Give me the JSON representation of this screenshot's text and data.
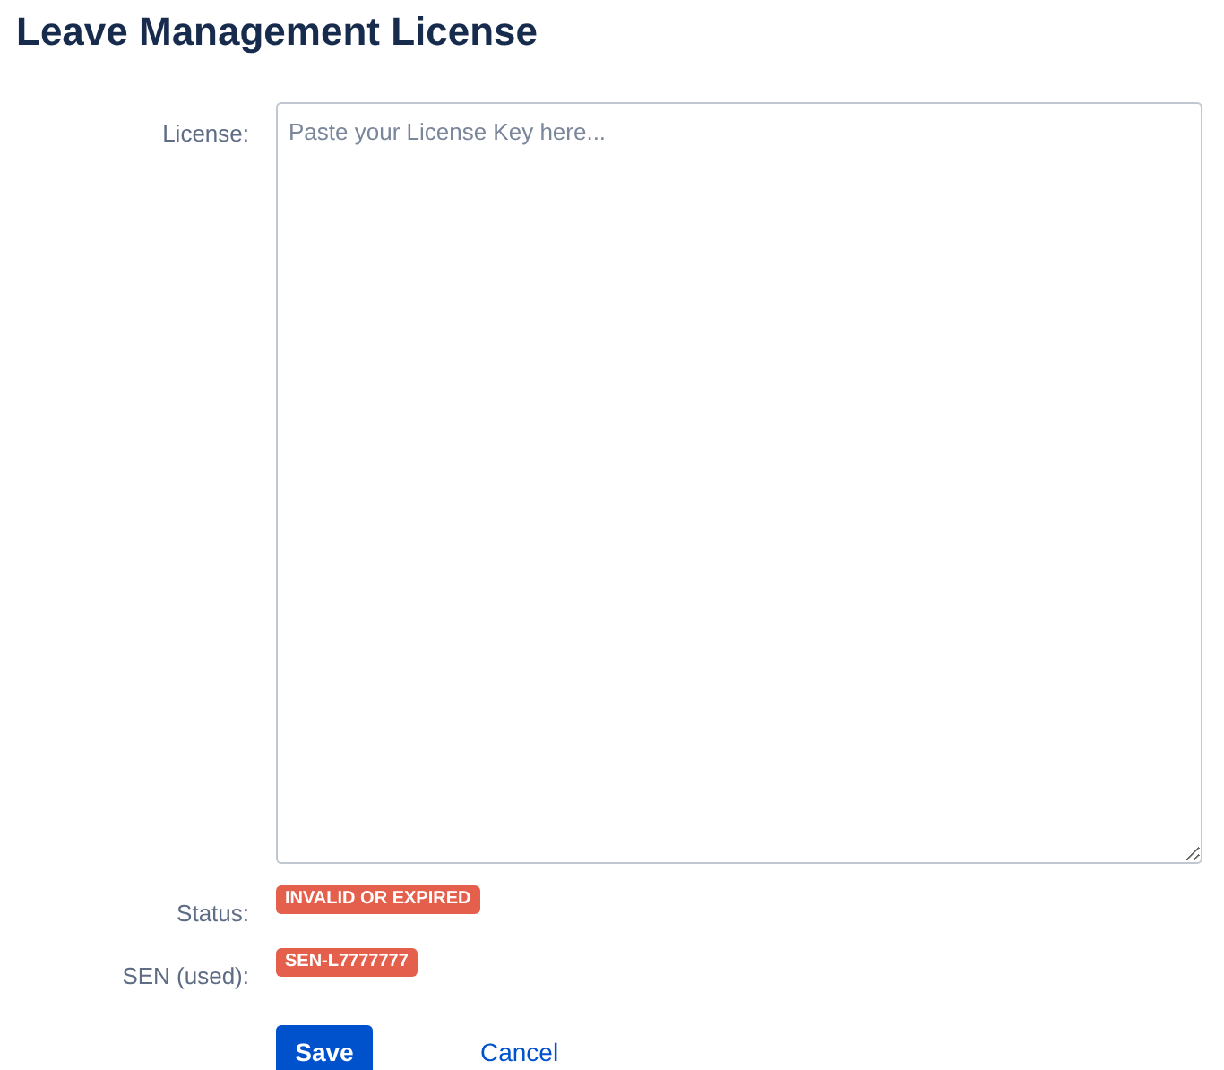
{
  "title": "Leave Management License",
  "fields": [
    {
      "kind": "textarea",
      "label": "License:",
      "placeholder": "Paste your License Key here..."
    },
    {
      "kind": "badge",
      "label": "Status:",
      "value": "INVALID OR EXPIRED"
    },
    {
      "kind": "badge",
      "label": "SEN (used):",
      "value": "SEN-L7777777"
    }
  ],
  "buttons": [
    {
      "kind": "primary",
      "label": "Save"
    },
    {
      "kind": "link",
      "label": "Cancel"
    }
  ]
}
